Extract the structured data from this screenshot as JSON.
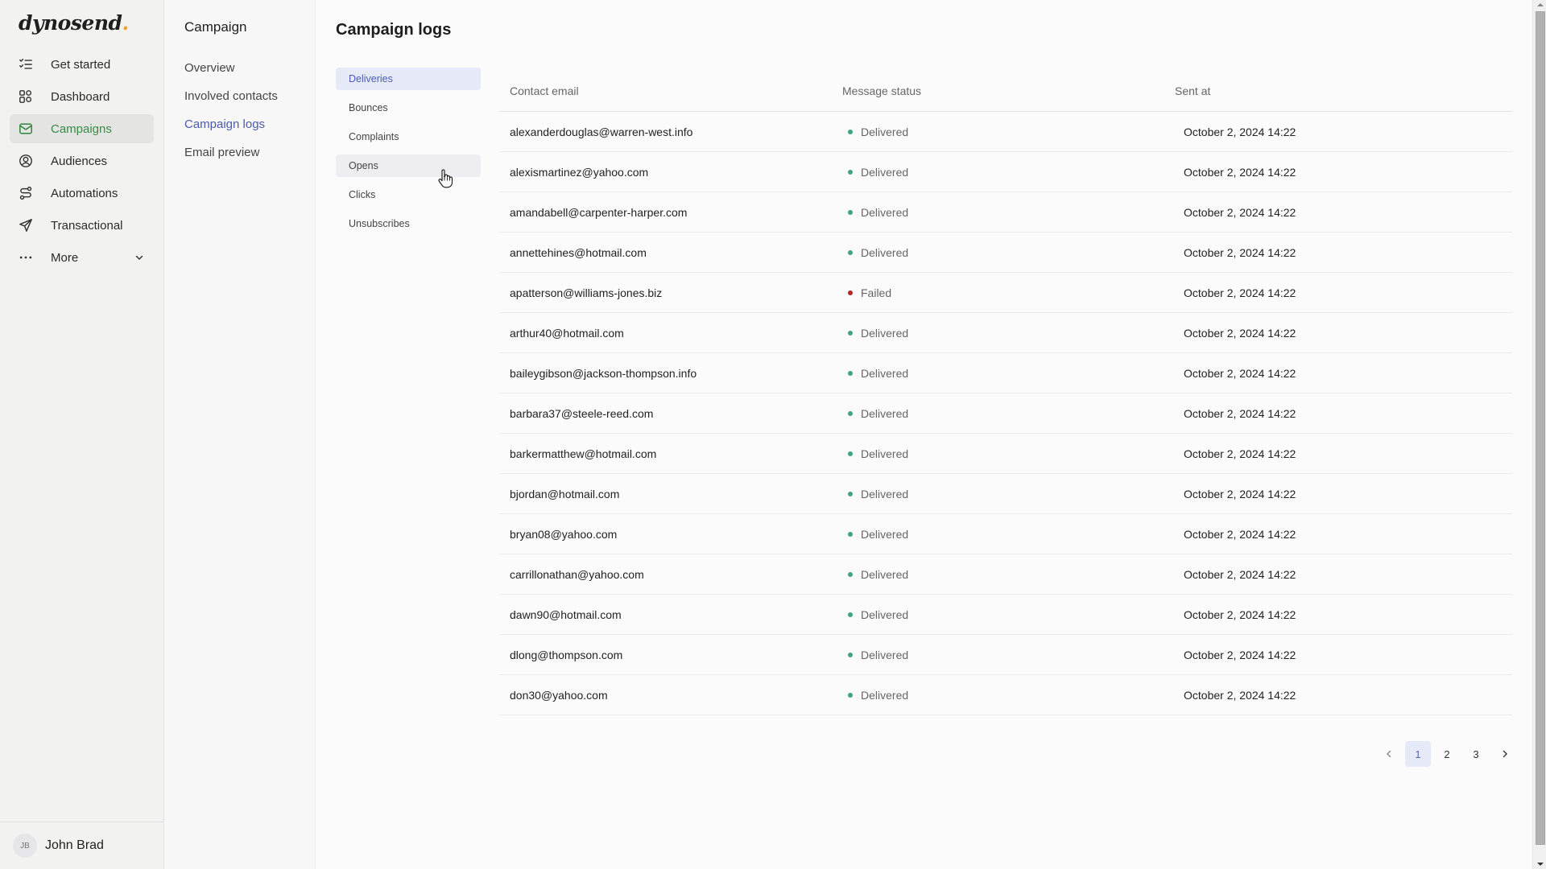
{
  "app": {
    "logo_text": "dynosend",
    "logo_dot": ".",
    "accent_color": "#3a8a4a",
    "link_color": "#4a5bb0"
  },
  "sidebar": {
    "items": [
      {
        "label": "Get started",
        "icon": "checklist-icon",
        "active": false
      },
      {
        "label": "Dashboard",
        "icon": "dashboard-grid-icon",
        "active": false
      },
      {
        "label": "Campaigns",
        "icon": "mail-icon",
        "active": true
      },
      {
        "label": "Audiences",
        "icon": "user-circle-icon",
        "active": false
      },
      {
        "label": "Automations",
        "icon": "workflow-icon",
        "active": false
      },
      {
        "label": "Transactional",
        "icon": "send-icon",
        "active": false
      },
      {
        "label": "More",
        "icon": "more-dots-icon",
        "active": false
      }
    ],
    "user": {
      "initials": "JB",
      "name": "John Brad"
    }
  },
  "subsidebar": {
    "title": "Campaign",
    "items": [
      {
        "label": "Overview",
        "active": false
      },
      {
        "label": "Involved contacts",
        "active": false
      },
      {
        "label": "Campaign logs",
        "active": true
      },
      {
        "label": "Email preview",
        "active": false
      }
    ]
  },
  "main": {
    "title": "Campaign logs",
    "tabs": [
      {
        "label": "Deliveries",
        "state": "active"
      },
      {
        "label": "Bounces",
        "state": ""
      },
      {
        "label": "Complaints",
        "state": ""
      },
      {
        "label": "Opens",
        "state": "hover"
      },
      {
        "label": "Clicks",
        "state": ""
      },
      {
        "label": "Unsubscribes",
        "state": ""
      }
    ],
    "table": {
      "columns": [
        "Contact email",
        "Message status",
        "Sent at"
      ],
      "status_colors": {
        "Delivered": "#3fa57a",
        "Failed": "#b82424"
      },
      "rows": [
        {
          "email": "alexanderdouglas@warren-west.info",
          "status": "Delivered",
          "sent_at": "October 2, 2024 14:22"
        },
        {
          "email": "alexismartinez@yahoo.com",
          "status": "Delivered",
          "sent_at": "October 2, 2024 14:22"
        },
        {
          "email": "amandabell@carpenter-harper.com",
          "status": "Delivered",
          "sent_at": "October 2, 2024 14:22"
        },
        {
          "email": "annettehines@hotmail.com",
          "status": "Delivered",
          "sent_at": "October 2, 2024 14:22"
        },
        {
          "email": "apatterson@williams-jones.biz",
          "status": "Failed",
          "sent_at": "October 2, 2024 14:22"
        },
        {
          "email": "arthur40@hotmail.com",
          "status": "Delivered",
          "sent_at": "October 2, 2024 14:22"
        },
        {
          "email": "baileygibson@jackson-thompson.info",
          "status": "Delivered",
          "sent_at": "October 2, 2024 14:22"
        },
        {
          "email": "barbara37@steele-reed.com",
          "status": "Delivered",
          "sent_at": "October 2, 2024 14:22"
        },
        {
          "email": "barkermatthew@hotmail.com",
          "status": "Delivered",
          "sent_at": "October 2, 2024 14:22"
        },
        {
          "email": "bjordan@hotmail.com",
          "status": "Delivered",
          "sent_at": "October 2, 2024 14:22"
        },
        {
          "email": "bryan08@yahoo.com",
          "status": "Delivered",
          "sent_at": "October 2, 2024 14:22"
        },
        {
          "email": "carrillonathan@yahoo.com",
          "status": "Delivered",
          "sent_at": "October 2, 2024 14:22"
        },
        {
          "email": "dawn90@hotmail.com",
          "status": "Delivered",
          "sent_at": "October 2, 2024 14:22"
        },
        {
          "email": "dlong@thompson.com",
          "status": "Delivered",
          "sent_at": "October 2, 2024 14:22"
        },
        {
          "email": "don30@yahoo.com",
          "status": "Delivered",
          "sent_at": "October 2, 2024 14:22"
        }
      ]
    },
    "pagination": {
      "pages": [
        "1",
        "2",
        "3"
      ],
      "current": "1"
    }
  }
}
